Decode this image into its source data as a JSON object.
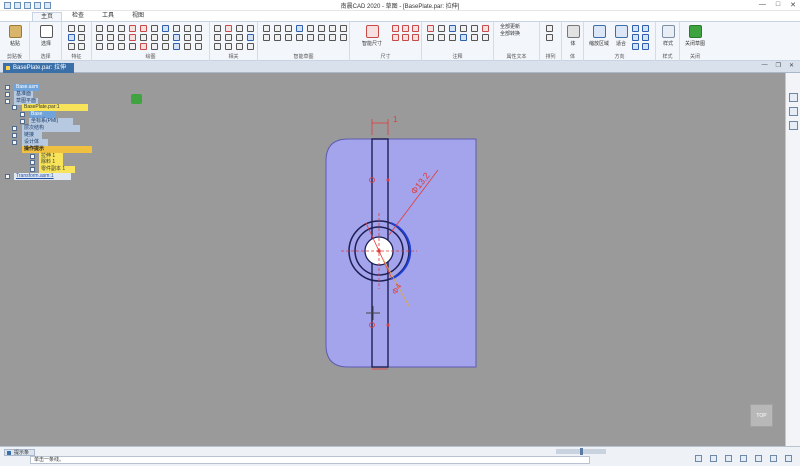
{
  "app": {
    "window_title": "南晨CAD 2020 - 草图 - [BasePlate.par: 拉伸]",
    "window_controls": [
      "—",
      "□",
      "✕"
    ]
  },
  "ribbon_tabs": [
    {
      "label": "主页",
      "active": true
    },
    {
      "label": "检查",
      "active": false
    },
    {
      "label": "工具",
      "active": false
    },
    {
      "label": "视图",
      "active": false
    }
  ],
  "ribbon": {
    "clipboard": {
      "paste_label": "粘贴",
      "group_label": "剪贴板"
    },
    "select": {
      "select_label": "选择",
      "group_label": "选择"
    },
    "features": {
      "group_label": "特征"
    },
    "draw": {
      "group_label": "绘图"
    },
    "relate": {
      "group_label": "相关"
    },
    "smart_sketch": {
      "group_label": "智能草图"
    },
    "dimension": {
      "smart_dim_label": "智能尺寸",
      "group_label": "尺寸"
    },
    "annotation": {
      "group_label": "注释"
    },
    "text": {
      "update_all_label": "全部更新",
      "convert_all_label": "全部转换",
      "group_label": "属性文本"
    },
    "array": {
      "group_label": "排列"
    },
    "body": {
      "label": "体",
      "group_label": "体"
    },
    "view": {
      "zoom_area_label": "缩放区域",
      "fit_label": "适合",
      "group_label": "方向"
    },
    "style": {
      "style_label": "样式",
      "group_label": "样式"
    },
    "close": {
      "close_sketch_label": "关闭草图",
      "group_label": "关闭"
    }
  },
  "document_tab": {
    "label": "BasePlate.par: 拉伸"
  },
  "tree": [
    {
      "label": "Base.asm"
    },
    {
      "label": "基准面"
    },
    {
      "label": "草图平面"
    },
    {
      "label": "BasePlate.par:1"
    },
    {
      "label": "Base"
    },
    {
      "label": "坐标系(PMI)"
    },
    {
      "label": "层次结构"
    },
    {
      "label": "链接"
    },
    {
      "label": "设计体"
    },
    {
      "label": "操作提示"
    },
    {
      "label": "拉伸 1"
    },
    {
      "label": "除料 1"
    },
    {
      "label": "零件副本 1"
    },
    {
      "label": "Transform.asm:1"
    }
  ],
  "drawing": {
    "plate_fill": "#a3a4ec",
    "diameter_large": "Φ13.2",
    "diameter_small": "Φ4",
    "dim_top": "1"
  },
  "view_cube": {
    "label": "TOP"
  },
  "status": {
    "prompt_tab": "提示条",
    "prompt_text": "单击一条线。"
  }
}
